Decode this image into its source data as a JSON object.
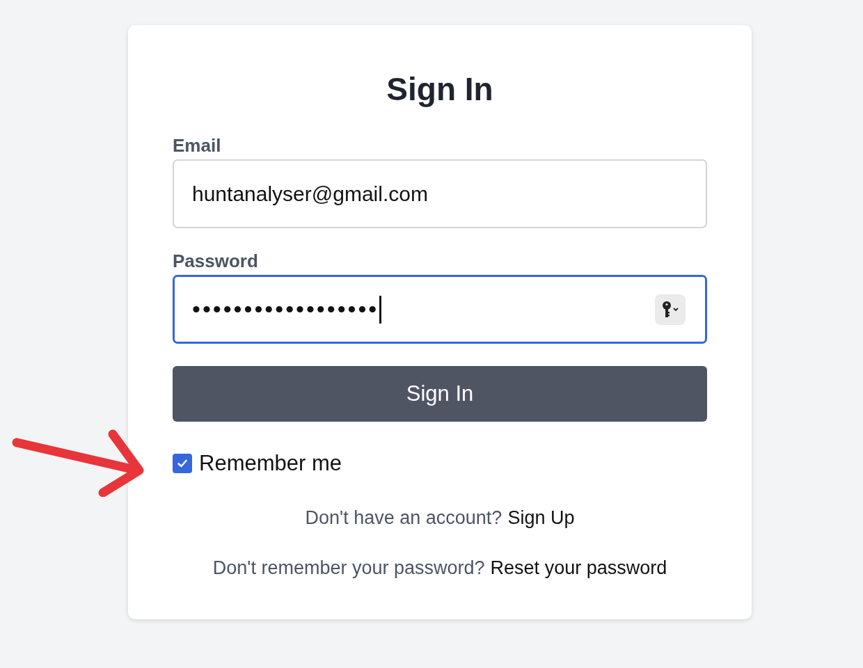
{
  "title": "Sign In",
  "fields": [
    {
      "kind": "text",
      "label": "Email",
      "value": "huntanalyser@gmail.com",
      "focused": false
    },
    {
      "kind": "password",
      "label": "Password",
      "value": "••••••••••••••••••",
      "focused": true
    }
  ],
  "submit": "Sign In",
  "remember": {
    "label": "Remember me",
    "checked": true
  },
  "links": [
    {
      "text": "Don't have an account?",
      "link": "Sign Up"
    },
    {
      "text": "Don't remember your password?",
      "link": "Reset your password"
    }
  ]
}
